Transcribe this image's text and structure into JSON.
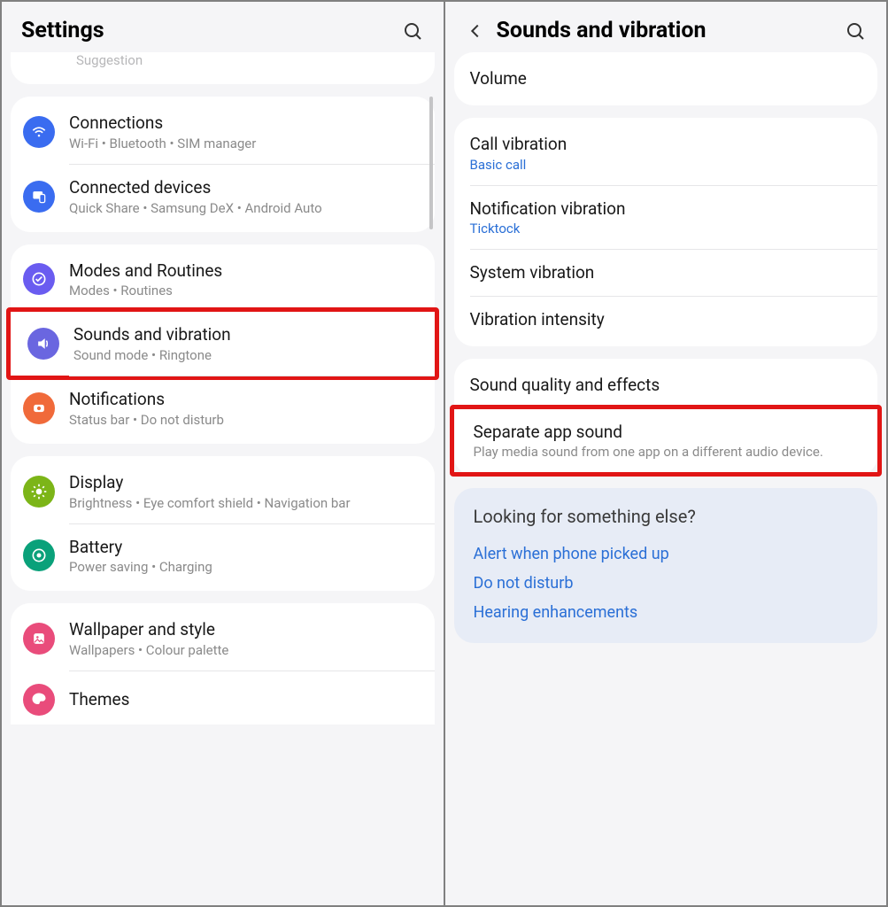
{
  "left": {
    "title": "Settings",
    "partial_top_text": "Suggestion",
    "groups": [
      {
        "items": [
          {
            "key": "connections",
            "title": "Connections",
            "sub": "Wi-Fi  •  Bluetooth  •  SIM manager",
            "icon": "wifi",
            "color": "#3a6cf0"
          },
          {
            "key": "connected-devices",
            "title": "Connected devices",
            "sub": "Quick Share  •  Samsung DeX  •  Android Auto",
            "icon": "devices",
            "color": "#3a6cf0"
          }
        ]
      },
      {
        "items": [
          {
            "key": "modes",
            "title": "Modes and Routines",
            "sub": "Modes  •  Routines",
            "icon": "modes",
            "color": "#6a5cf0"
          },
          {
            "key": "sounds",
            "title": "Sounds and vibration",
            "sub": "Sound mode  •  Ringtone",
            "icon": "sound",
            "color": "#6a66e0",
            "highlighted": true
          },
          {
            "key": "notifications",
            "title": "Notifications",
            "sub": "Status bar  •  Do not disturb",
            "icon": "notif",
            "color": "#f06a3a"
          }
        ]
      },
      {
        "items": [
          {
            "key": "display",
            "title": "Display",
            "sub": "Brightness  •  Eye comfort shield  •  Navigation bar",
            "icon": "display",
            "color": "#7cb518"
          },
          {
            "key": "battery",
            "title": "Battery",
            "sub": "Power saving  •  Charging",
            "icon": "battery",
            "color": "#0aa17a"
          }
        ]
      },
      {
        "items": [
          {
            "key": "wallpaper",
            "title": "Wallpaper and style",
            "sub": "Wallpapers  •  Colour palette",
            "icon": "wallpaper",
            "color": "#e94c7b"
          },
          {
            "key": "themes",
            "title": "Themes",
            "sub": "",
            "icon": "themes",
            "color": "#e94c7b"
          }
        ]
      }
    ]
  },
  "right": {
    "title": "Sounds and vibration",
    "groups": [
      {
        "items": [
          {
            "key": "volume",
            "title": "Volume"
          }
        ]
      },
      {
        "items": [
          {
            "key": "call-vib",
            "title": "Call vibration",
            "sub": "Basic call",
            "sublink": true
          },
          {
            "key": "notif-vib",
            "title": "Notification vibration",
            "sub": "Ticktock",
            "sublink": true
          },
          {
            "key": "sys-vib",
            "title": "System vibration"
          },
          {
            "key": "vib-int",
            "title": "Vibration intensity"
          }
        ]
      },
      {
        "items": [
          {
            "key": "sound-quality",
            "title": "Sound quality and effects"
          },
          {
            "key": "separate-app",
            "title": "Separate app sound",
            "sub": "Play media sound from one app on a different audio device.",
            "highlighted": true
          }
        ]
      }
    ],
    "looking": {
      "title": "Looking for something else?",
      "links": [
        "Alert when phone picked up",
        "Do not disturb",
        "Hearing enhancements"
      ]
    }
  }
}
